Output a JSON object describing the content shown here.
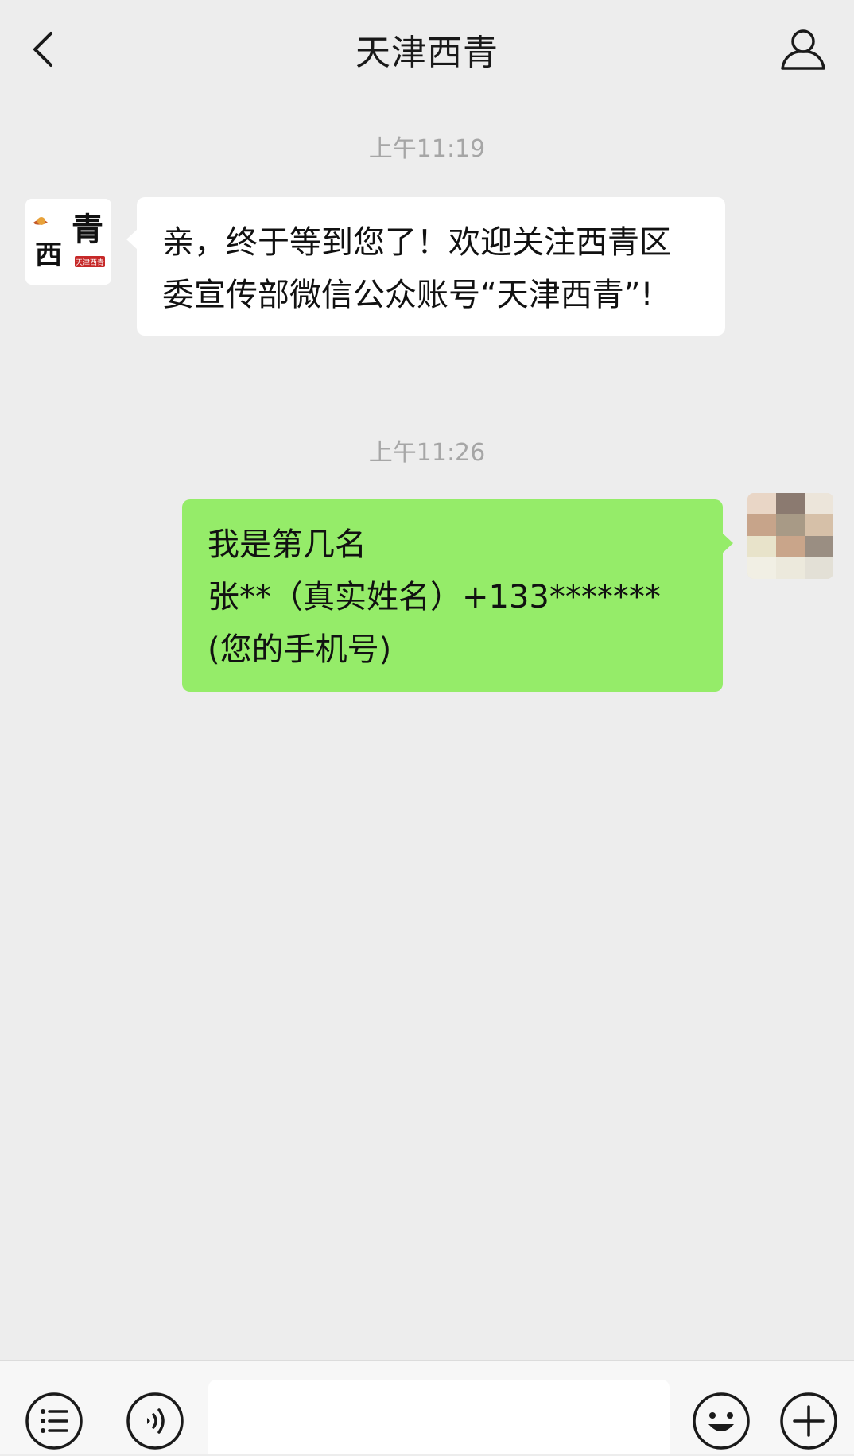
{
  "header": {
    "title": "天津西青",
    "back_icon": "chevron-left-icon",
    "profile_icon": "person-icon"
  },
  "messages": [
    {
      "time": "上午11:19",
      "side": "left",
      "text": "亲，终于等到您了！欢迎关注西青区委宣传部微信公众账号“天津西青”!",
      "avatar_text": "青",
      "avatar_text2": "西",
      "avatar_badge": "天津西青"
    },
    {
      "time": "上午11:26",
      "side": "right",
      "text": "我是第几名\n张**（真实姓名）+133*******\n(您的手机号)"
    }
  ],
  "input_bar": {
    "menu_icon": "list-menu-icon",
    "voice_icon": "voice-icon",
    "emoji_icon": "smiley-icon",
    "more_icon": "plus-icon",
    "input_value": ""
  },
  "colors": {
    "background": "#ededed",
    "bubble_sent": "#95ec69",
    "bubble_received": "#ffffff",
    "time_text": "#a6a6a6"
  }
}
